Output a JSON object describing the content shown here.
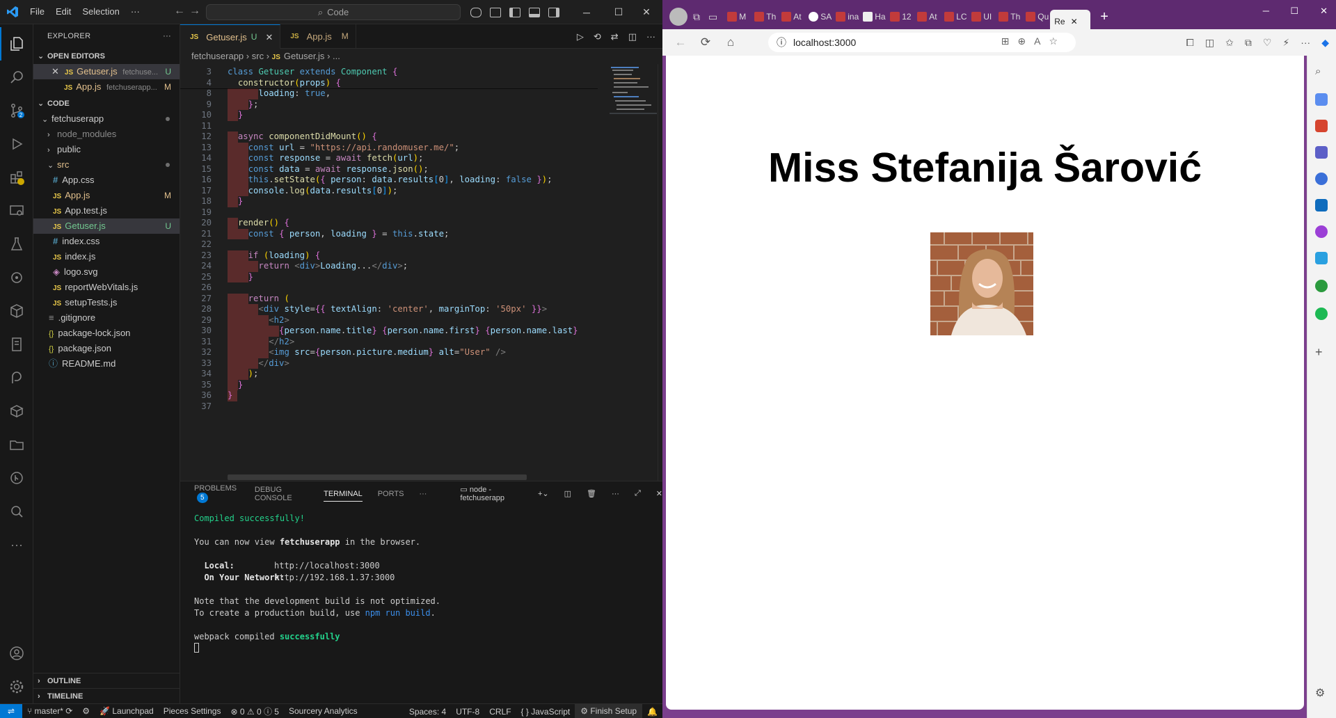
{
  "vscode": {
    "menu": [
      "File",
      "Edit",
      "Selection",
      "···"
    ],
    "command_center": "Code",
    "explorer_title": "EXPLORER",
    "open_editors_title": "OPEN EDITORS",
    "open_editors": [
      {
        "name": "Getuser.js",
        "path": "fetchuse...",
        "status": "U"
      },
      {
        "name": "App.js",
        "path": "fetchuserapp...",
        "status": "M"
      }
    ],
    "folder_title": "CODE",
    "tree": {
      "root": "fetchuserapp",
      "node_modules": "node_modules",
      "public": "public",
      "src": "src",
      "src_files": [
        {
          "name": "App.css",
          "type": "css",
          "status": ""
        },
        {
          "name": "App.js",
          "type": "js",
          "status": "M"
        },
        {
          "name": "App.test.js",
          "type": "js",
          "status": ""
        },
        {
          "name": "Getuser.js",
          "type": "js",
          "status": "U"
        },
        {
          "name": "index.css",
          "type": "css",
          "status": ""
        },
        {
          "name": "index.js",
          "type": "js",
          "status": ""
        },
        {
          "name": "logo.svg",
          "type": "svg",
          "status": ""
        },
        {
          "name": "reportWebVitals.js",
          "type": "js",
          "status": ""
        },
        {
          "name": "setupTests.js",
          "type": "js",
          "status": ""
        }
      ],
      "root_files": [
        {
          "name": ".gitignore",
          "type": "git"
        },
        {
          "name": "package-lock.json",
          "type": "json"
        },
        {
          "name": "package.json",
          "type": "json"
        },
        {
          "name": "README.md",
          "type": "info"
        }
      ]
    },
    "outline_title": "OUTLINE",
    "timeline_title": "TIMELINE",
    "tabs": [
      {
        "label": "Getuser.js",
        "status": "U",
        "active": true
      },
      {
        "label": "App.js",
        "status": "M",
        "active": false
      }
    ],
    "breadcrumb": [
      "fetchuserapp",
      "src",
      "Getuser.js",
      "..."
    ],
    "code_lines": [
      {
        "n": "3",
        "text": "class Getuser extends Component {"
      },
      {
        "n": "4",
        "text": "  constructor(props) {"
      },
      {
        "n": "8",
        "text": "      loading: true,"
      },
      {
        "n": "9",
        "text": "    };"
      },
      {
        "n": "10",
        "text": "  }"
      },
      {
        "n": "11",
        "text": ""
      },
      {
        "n": "12",
        "text": "  async componentDidMount() {"
      },
      {
        "n": "13",
        "text": "    const url = \"https://api.randomuser.me/\";"
      },
      {
        "n": "14",
        "text": "    const response = await fetch(url);"
      },
      {
        "n": "15",
        "text": "    const data = await response.json();"
      },
      {
        "n": "16",
        "text": "    this.setState({ person: data.results[0], loading: false });"
      },
      {
        "n": "17",
        "text": "    console.log(data.results[0]);"
      },
      {
        "n": "18",
        "text": "  }"
      },
      {
        "n": "19",
        "text": ""
      },
      {
        "n": "20",
        "text": "  render() {"
      },
      {
        "n": "21",
        "text": "    const { person, loading } = this.state;"
      },
      {
        "n": "22",
        "text": ""
      },
      {
        "n": "23",
        "text": "    if (loading) {"
      },
      {
        "n": "24",
        "text": "      return <div>Loading...</div>;"
      },
      {
        "n": "25",
        "text": "    }"
      },
      {
        "n": "26",
        "text": ""
      },
      {
        "n": "27",
        "text": "    return ("
      },
      {
        "n": "28",
        "text": "      <div style={{ textAlign: 'center', marginTop: '50px' }}>"
      },
      {
        "n": "29",
        "text": "        <h2>"
      },
      {
        "n": "30",
        "text": "          {person.name.title} {person.name.first} {person.name.last}"
      },
      {
        "n": "31",
        "text": "        </h2>"
      },
      {
        "n": "32",
        "text": "        <img src={person.picture.medium} alt=\"User\" />"
      },
      {
        "n": "33",
        "text": "      </div>"
      },
      {
        "n": "34",
        "text": "    );"
      },
      {
        "n": "35",
        "text": "  }"
      },
      {
        "n": "36",
        "text": "}"
      },
      {
        "n": "37",
        "text": ""
      }
    ],
    "panel_tabs": [
      "PROBLEMS",
      "DEBUG CONSOLE",
      "TERMINAL",
      "PORTS",
      "···"
    ],
    "problems_count": "5",
    "terminal_name": "node - fetchuserapp",
    "terminal": {
      "l1": "Compiled successfully!",
      "l2a": "You can now view ",
      "l2b": "fetchuserapp",
      "l2c": " in the browser.",
      "local_label": "  Local:",
      "local_url": "http://localhost:3000",
      "network_label": "  On Your Network:",
      "network_url": "http://192.168.1.37:3000",
      "note1": "Note that the development build is not optimized.",
      "note2a": "To create a production build, use ",
      "note2b": "npm run build",
      "note2c": ".",
      "wp_a": "webpack compiled ",
      "wp_b": "successfully"
    },
    "status": {
      "branch": "master*",
      "launchpad": "Launchpad",
      "pieces": "Pieces Settings",
      "problems": "⊗ 0 ⚠ 0 ⓘ 5",
      "sourcery": "Sourcery Analytics",
      "spaces": "Spaces: 4",
      "encoding": "UTF-8",
      "eol": "CRLF",
      "language": "{ } JavaScript",
      "finish": "Finish Setup"
    }
  },
  "edge": {
    "tab_labels": [
      "M",
      "Th",
      "At",
      "SA",
      "ina",
      "Ha",
      "12",
      "At",
      "LC",
      "UI",
      "Th",
      "Qu"
    ],
    "active_tab": "Re",
    "url": "localhost:3000",
    "page": {
      "heading": "Miss Stefanija Šarović",
      "image_alt": "User"
    }
  },
  "colors": {
    "vscode_bg": "#1f1f1f",
    "accent": "#0078d4",
    "edge_frame": "#7b3f8d"
  }
}
